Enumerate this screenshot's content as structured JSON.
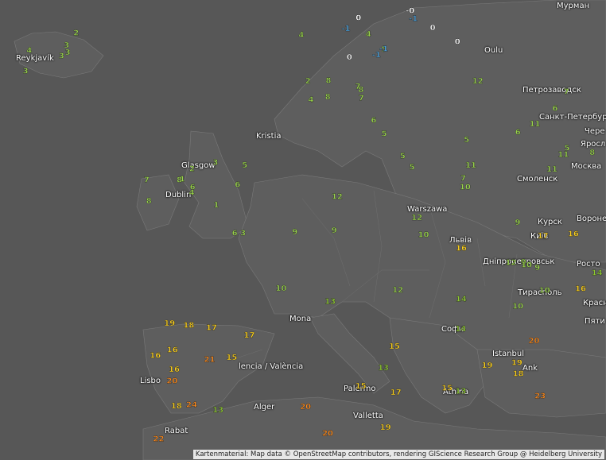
{
  "map": {
    "attribution": "Kartenmaterial: Map data © OpenStreetMap contributors, rendering GIScience Research Group @ Heidelberg University",
    "cities": [
      {
        "label": "Reykjavík"
      },
      {
        "label": "Kristia"
      },
      {
        "label": "Glasgow"
      },
      {
        "label": "Dublin"
      },
      {
        "label": "Petrozavodsk",
        "display": "Петрозаводск"
      },
      {
        "label": "Sankt-Peterburg",
        "display": "Санкт-Петербург"
      },
      {
        "label": "Moskva",
        "display": "Москва"
      },
      {
        "label": "Yaroslavl",
        "display": "Яросл"
      },
      {
        "label": "Smolensk",
        "display": "Смоленск"
      },
      {
        "label": "Kyiv",
        "display": "Київ"
      },
      {
        "label": "Lviv",
        "display": "Львів"
      },
      {
        "label": "Warszawa",
        "display": "Warszawa"
      },
      {
        "label": "Dnipropetrovsk",
        "display": "Дніпропетровськ"
      },
      {
        "label": "Tiraspol",
        "display": "Тирасполь"
      },
      {
        "label": "Kursk",
        "display": "Курск"
      },
      {
        "label": "Voronezh",
        "display": "Вороне"
      },
      {
        "label": "Rostov",
        "display": "Росто"
      },
      {
        "label": "Krasnodar",
        "display": "Красно"
      },
      {
        "label": "Istanbul",
        "display": "Istanbul"
      },
      {
        "label": "Ankara",
        "display": "Ank"
      },
      {
        "label": "Athina",
        "display": "Athina"
      },
      {
        "label": "Sofia",
        "display": "Софи"
      },
      {
        "label": "Palermo",
        "display": "Palermo"
      },
      {
        "label": "Valletta",
        "display": "Valletta"
      },
      {
        "label": "Alger",
        "display": "Alger"
      },
      {
        "label": "Rabat",
        "display": "Rabat"
      },
      {
        "label": "Lisboa",
        "display": "Lisbo"
      },
      {
        "label": "Valencia",
        "display": "lencia / València"
      },
      {
        "label": "Monaco",
        "display": "Mona"
      },
      {
        "label": "Oulu",
        "display": "Oulu"
      },
      {
        "label": "Murmansk",
        "display": "Мурман"
      },
      {
        "label": "Cherepovets",
        "display": "Чере"
      },
      {
        "label": "Pyatigorsk",
        "display": "Пяти"
      }
    ],
    "temperatures": [
      {
        "v": "3"
      },
      {
        "v": "4"
      },
      {
        "v": "4"
      },
      {
        "v": "3"
      },
      {
        "v": "5"
      },
      {
        "v": "-1"
      },
      {
        "v": "2"
      },
      {
        "v": "4"
      },
      {
        "v": "3"
      },
      {
        "v": "3"
      },
      {
        "v": "6"
      },
      {
        "v": "3"
      },
      {
        "v": "4"
      },
      {
        "v": "5"
      },
      {
        "v": "5"
      },
      {
        "v": "6"
      },
      {
        "v": "4"
      },
      {
        "v": "2"
      },
      {
        "v": "3"
      },
      {
        "v": "2"
      },
      {
        "v": "1"
      },
      {
        "v": "0"
      },
      {
        "v": "-1"
      },
      {
        "v": "-1"
      },
      {
        "v": "0"
      },
      {
        "v": "0"
      },
      {
        "v": "0"
      },
      {
        "v": "-0"
      },
      {
        "v": "-1"
      },
      {
        "v": "1"
      },
      {
        "v": "5"
      },
      {
        "v": "6"
      },
      {
        "v": "7"
      },
      {
        "v": "6"
      },
      {
        "v": "5"
      },
      {
        "v": "7"
      },
      {
        "v": "8"
      },
      {
        "v": "6"
      },
      {
        "v": "7"
      },
      {
        "v": "5"
      },
      {
        "v": "9"
      },
      {
        "v": "8"
      },
      {
        "v": "9"
      },
      {
        "v": "10"
      },
      {
        "v": "8"
      },
      {
        "v": "7"
      },
      {
        "v": "9"
      },
      {
        "v": "10"
      },
      {
        "v": "8"
      },
      {
        "v": "10"
      },
      {
        "v": "11"
      },
      {
        "v": "12"
      },
      {
        "v": "10"
      },
      {
        "v": "11"
      },
      {
        "v": "13"
      },
      {
        "v": "14"
      },
      {
        "v": "12"
      },
      {
        "v": "13"
      },
      {
        "v": "15"
      },
      {
        "v": "16"
      },
      {
        "v": "17"
      },
      {
        "v": "18"
      },
      {
        "v": "15"
      },
      {
        "v": "16"
      },
      {
        "v": "17"
      },
      {
        "v": "19"
      },
      {
        "v": "20"
      },
      {
        "v": "20"
      },
      {
        "v": "21"
      },
      {
        "v": "22"
      },
      {
        "v": "23"
      },
      {
        "v": "24"
      },
      {
        "v": "20"
      },
      {
        "v": "19"
      },
      {
        "v": "17"
      },
      {
        "v": "18"
      },
      {
        "v": "16"
      },
      {
        "v": "8"
      },
      {
        "v": "9"
      },
      {
        "v": "10"
      },
      {
        "v": "11"
      },
      {
        "v": "10"
      },
      {
        "v": "9"
      },
      {
        "v": "8"
      },
      {
        "v": "7"
      },
      {
        "v": "6"
      },
      {
        "v": "5"
      },
      {
        "v": "12"
      },
      {
        "v": "13"
      },
      {
        "v": "11"
      },
      {
        "v": "12"
      },
      {
        "v": "14"
      },
      {
        "v": "15"
      },
      {
        "v": "13"
      },
      {
        "v": "12"
      },
      {
        "v": "16"
      },
      {
        "v": "16"
      },
      {
        "v": "15"
      },
      {
        "v": "14"
      },
      {
        "v": "17"
      },
      {
        "v": "16"
      },
      {
        "v": "18"
      },
      {
        "v": "19"
      },
      {
        "v": "19"
      },
      {
        "v": "20"
      }
    ],
    "colors": {
      "sea": "#575757",
      "land": "#5e5e5e",
      "cold": "#4aa3df",
      "freezing": "#ffffff",
      "cool": "#9ad64a",
      "mild": "#8fcc2f",
      "warm": "#ffd21a",
      "hot": "#ff8a1a"
    }
  }
}
